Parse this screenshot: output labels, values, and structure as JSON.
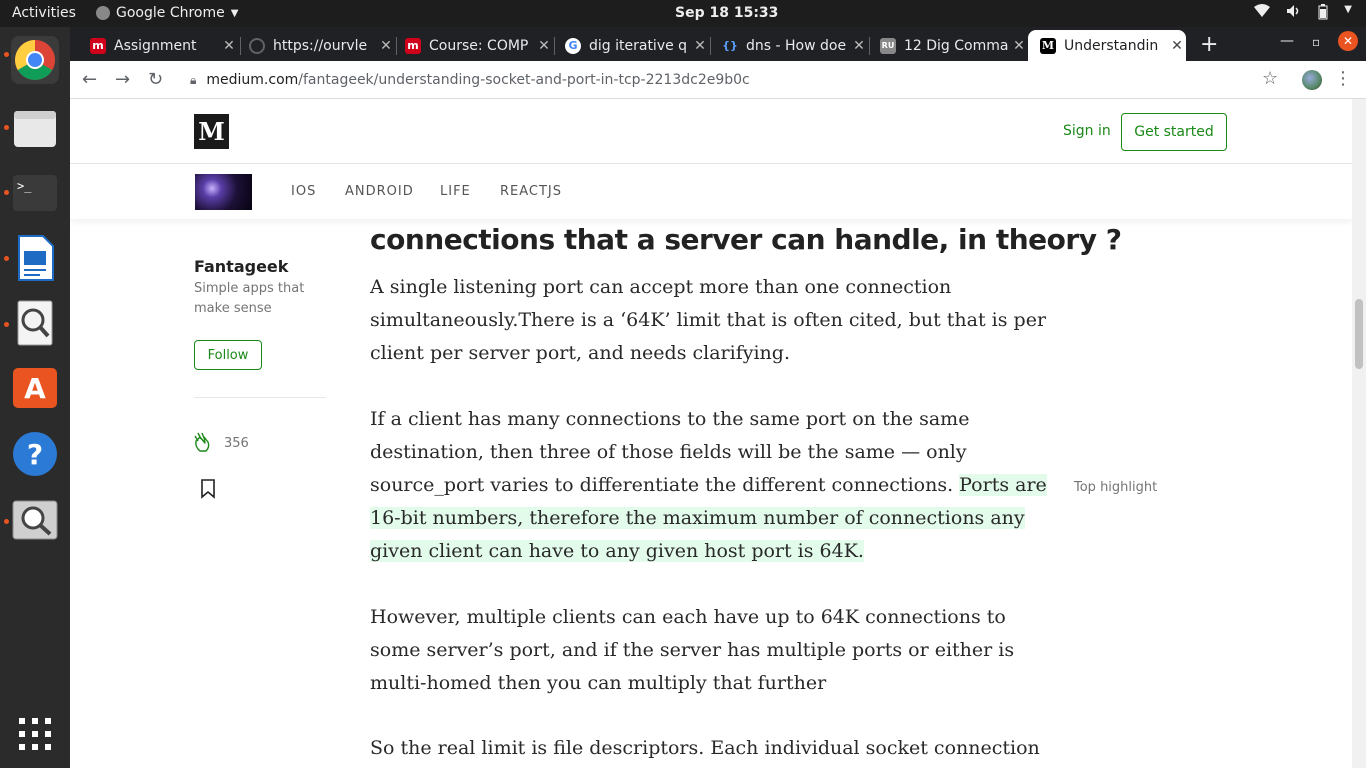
{
  "system": {
    "activities": "Activities",
    "app_name": "Google Chrome",
    "clock": "Sep 18  15:33"
  },
  "tabs": [
    {
      "title": "Assignment",
      "favicon_color": "#d0011b"
    },
    {
      "title": "https://ourvle",
      "favicon_color": "#5f6368"
    },
    {
      "title": "Course: COMP",
      "favicon_color": "#d0011b"
    },
    {
      "title": "dig iterative q",
      "favicon_color": "#4285f4"
    },
    {
      "title": "dns - How doe",
      "favicon_color": "#1f62b6"
    },
    {
      "title": "12 Dig Comma",
      "favicon_color": "#888888"
    },
    {
      "title": "Understandin",
      "favicon_color": "#000000"
    }
  ],
  "url": {
    "host": "medium.com",
    "path": "/fantageek/understanding-socket-and-port-in-tcp-2213dc2e9b0c"
  },
  "medium": {
    "logo": "M",
    "sign_in": "Sign in",
    "get_started": "Get started",
    "nav": [
      "IOS",
      "ANDROID",
      "LIFE",
      "REACTJS"
    ]
  },
  "author": {
    "name": "Fantageek",
    "description": "Simple apps that make sense",
    "follow": "Follow",
    "claps": "356"
  },
  "article": {
    "heading": "connections that a server can handle, in theory ?",
    "p1": "A single listening port can accept more than one connection simultaneously.There is a ‘64K’ limit that is often cited, but that is per client per server port, and needs clarifying.",
    "p2_plain": "If a client has many connections to the same port on the same destination, then three of those fields will be the same — only source_port varies to differentiate the different connections. ",
    "p2_highlight": "Ports are 16-bit numbers, therefore the maximum number of connections any given client can have to any given host port is 64K.",
    "top_highlight": "Top highlight",
    "p3": "However, multiple clients can each have up to 64K connections to some server’s port, and if the server has multiple ports or either is multi-homed then you can multiply that further",
    "p4": "So the real limit is file descriptors. Each individual socket connection is"
  },
  "colors": {
    "medium_green": "#1a8917",
    "highlight": "#e3fbeb"
  }
}
